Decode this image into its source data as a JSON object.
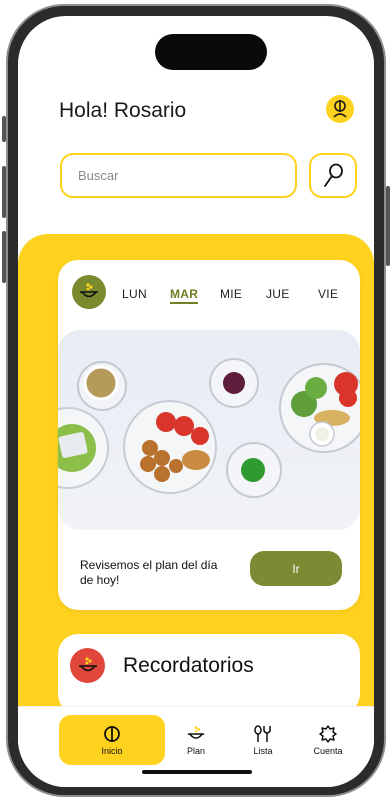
{
  "header": {
    "greeting": "Hola! Rosario",
    "avatar_icon": "user-icon"
  },
  "search": {
    "placeholder": "Buscar",
    "button_icon": "search-icon"
  },
  "day_card": {
    "plan_icon": "bowl-icon",
    "days": [
      {
        "label": "LUN",
        "active": false
      },
      {
        "label": "MAR",
        "active": true
      },
      {
        "label": "MIE",
        "active": false
      },
      {
        "label": "JUE",
        "active": false
      },
      {
        "label": "VIE",
        "active": false
      }
    ],
    "photo": "plates-of-food-photo",
    "review_text": "Revisemos el plan del día de hoy!",
    "go_label": "Ir"
  },
  "reminders": {
    "title": "Recordatorios",
    "icon": "bowl-icon"
  },
  "tabbar": {
    "items": [
      {
        "label": "Inicio",
        "icon": "home-circle-icon",
        "active": true
      },
      {
        "label": "Plan",
        "icon": "bowl-icon",
        "active": false
      },
      {
        "label": "Lista",
        "icon": "utensils-icon",
        "active": false
      },
      {
        "label": "Cuenta",
        "icon": "gear-icon",
        "active": false
      }
    ]
  },
  "colors": {
    "accent": "#FFD21F",
    "olive": "#7C8A33",
    "reminder": "#E0463A"
  }
}
